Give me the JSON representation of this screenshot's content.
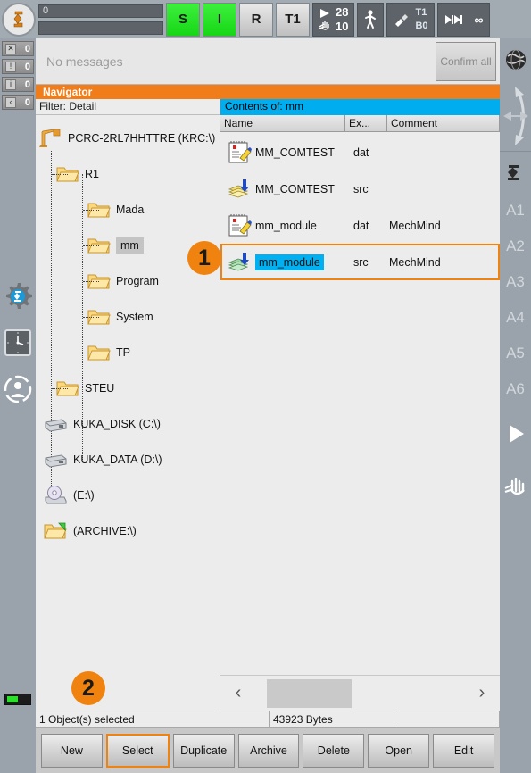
{
  "statusbar": {
    "logo_icon": "kuka-robot-logo-icon",
    "submit_line1": "0",
    "submit_line2": "",
    "buttons": [
      {
        "label": "S",
        "state": "green",
        "name": "drives-ready-button"
      },
      {
        "label": "I",
        "state": "green",
        "name": "interpreter-status-button"
      },
      {
        "label": "R",
        "state": "gray",
        "name": "robot-interpreter-button"
      },
      {
        "label": "T1",
        "state": "gray",
        "name": "operating-mode-button"
      }
    ],
    "override": {
      "program_icon": "play-triangle-icon",
      "jog_icon": "hand-jog-icon",
      "program_value": "28",
      "jog_value": "10"
    },
    "walk_icon": "walking-person-icon",
    "tool_base": {
      "icon": "tool-base-icon",
      "tool": "T1",
      "base": "B0"
    },
    "increment_icon": "incremental-jog-icon",
    "infinity_label": "∞"
  },
  "leftrail": {
    "counters": [
      {
        "icon": "error-message-icon",
        "glyph": "✕",
        "count": "0",
        "name": "counter-errors"
      },
      {
        "icon": "warning-message-icon",
        "glyph": "!",
        "count": "0",
        "name": "counter-warnings"
      },
      {
        "icon": "info-message-icon",
        "glyph": "i",
        "count": "0",
        "name": "counter-notes"
      },
      {
        "icon": "wait-message-icon",
        "glyph": "‹",
        "count": "0",
        "name": "counter-waiting"
      }
    ],
    "icons": [
      {
        "name": "robot-settings-gear-icon"
      },
      {
        "name": "clock-icon"
      },
      {
        "name": "user-group-icon"
      }
    ],
    "battery": {
      "name": "battery-indicator",
      "level": "50"
    }
  },
  "rightrail": {
    "globe_icon": "world-coordinate-globe-icon",
    "jog_icon": "jog-direction-arrows-icon",
    "robot_icon": "robot-axis-icon",
    "axes": [
      "A1",
      "A2",
      "A3",
      "A4",
      "A5",
      "A6"
    ],
    "play_icon": "play-triangle-icon",
    "hand_icon": "hand-jog-icon"
  },
  "message_bar": {
    "text": "No messages",
    "confirm_label": "Confirm all"
  },
  "navigator": {
    "title": "Navigator",
    "filter_label": "Filter: Detail",
    "tree": [
      {
        "label": "PCRC-2RL7HHTTRE (KRC:\\)",
        "icon": "robot-controller-icon",
        "depth": 0,
        "selected": false
      },
      {
        "label": "R1",
        "icon": "folder-icon",
        "depth": 1,
        "selected": false
      },
      {
        "label": "Mada",
        "icon": "folder-icon",
        "depth": 2,
        "selected": false
      },
      {
        "label": "mm",
        "icon": "folder-icon",
        "depth": 2,
        "selected": true
      },
      {
        "label": "Program",
        "icon": "folder-icon",
        "depth": 2,
        "selected": false
      },
      {
        "label": "System",
        "icon": "folder-icon",
        "depth": 2,
        "selected": false
      },
      {
        "label": "TP",
        "icon": "folder-icon",
        "depth": 2,
        "selected": false
      },
      {
        "label": "STEU",
        "icon": "folder-icon",
        "depth": 1,
        "selected": false
      },
      {
        "label": "KUKA_DISK (C:\\)",
        "icon": "hard-disk-icon",
        "depth": 0,
        "selected": false
      },
      {
        "label": "KUKA_DATA (D:\\)",
        "icon": "hard-disk-icon",
        "depth": 0,
        "selected": false
      },
      {
        "label": "(E:\\)",
        "icon": "cd-drive-icon",
        "depth": 0,
        "selected": false
      },
      {
        "label": "(ARCHIVE:\\)",
        "icon": "archive-folder-icon",
        "depth": 0,
        "selected": false
      }
    ]
  },
  "contents": {
    "header": "Contents of: mm",
    "columns": [
      "Name",
      "Ex...",
      "Comment"
    ],
    "rows": [
      {
        "name": "MM_COMTEST",
        "ext": "dat",
        "comment": "",
        "icon": "dat-file-icon",
        "selected": false
      },
      {
        "name": "MM_COMTEST",
        "ext": "src",
        "comment": "",
        "icon": "src-file-icon",
        "selected": false
      },
      {
        "name": "mm_module",
        "ext": "dat",
        "comment": "MechMind",
        "icon": "dat-file-icon",
        "selected": false
      },
      {
        "name": "mm_module",
        "ext": "src",
        "comment": "MechMind",
        "icon": "src-file-icon-selected",
        "selected": true
      }
    ],
    "scroll": {
      "left_icon": "chevron-left-icon",
      "right_icon": "chevron-right-icon"
    }
  },
  "status_row": {
    "selection": "1 Object(s) selected",
    "bytes": "43923 Bytes",
    "extra": ""
  },
  "buttons": [
    {
      "label": "New",
      "name": "new-button",
      "focus": false
    },
    {
      "label": "Select",
      "name": "select-button",
      "focus": true
    },
    {
      "label": "Duplicate",
      "name": "duplicate-button",
      "focus": false
    },
    {
      "label": "Archive",
      "name": "archive-button",
      "focus": false
    },
    {
      "label": "Delete",
      "name": "delete-button",
      "focus": false
    },
    {
      "label": "Open",
      "name": "open-button",
      "focus": false
    },
    {
      "label": "Edit",
      "name": "edit-button",
      "focus": false
    }
  ],
  "annotations": [
    {
      "label": "1",
      "target": "mm-folder-tree-node"
    },
    {
      "label": "2",
      "target": "select-button"
    }
  ],
  "colors": {
    "accent_orange": "#f0830f",
    "header_cyan": "#00aef0",
    "status_green": "#16d616",
    "selection_blue": "#00b0f0"
  }
}
